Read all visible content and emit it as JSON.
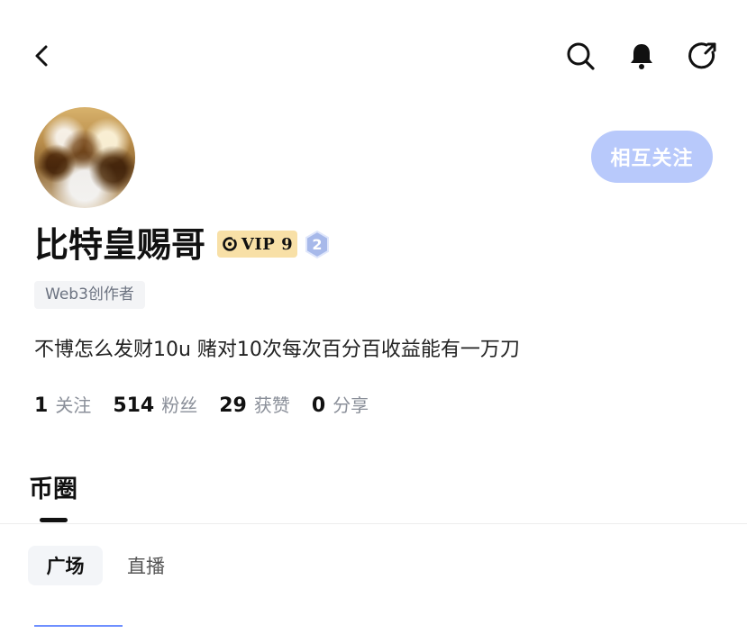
{
  "header": {
    "back_icon": "chevron-left-icon",
    "search_icon": "search-icon",
    "bell_icon": "bell-icon",
    "share_icon": "share-icon"
  },
  "profile": {
    "display_name": "比特皇赐哥",
    "vip_label": "VIP 9",
    "level": "2",
    "tag": "Web3创作者",
    "bio": "不博怎么发财10u 赌对10次每次百分百收益能有一万刀",
    "follow_button": "相互关注",
    "stats": [
      {
        "count": "1",
        "label": "关注"
      },
      {
        "count": "514",
        "label": "粉丝"
      },
      {
        "count": "29",
        "label": "获赞"
      },
      {
        "count": "0",
        "label": "分享"
      }
    ]
  },
  "tabs": {
    "section_title": "币圈",
    "subtabs": [
      {
        "label": "广场",
        "active": true
      },
      {
        "label": "直播",
        "active": false
      }
    ]
  },
  "colors": {
    "accent_blue": "#b8c9fb",
    "vip_gold": "#f8e0a7",
    "level_blue": "#a7b9ea",
    "text_primary": "#111111",
    "text_secondary": "#8a8f99"
  }
}
